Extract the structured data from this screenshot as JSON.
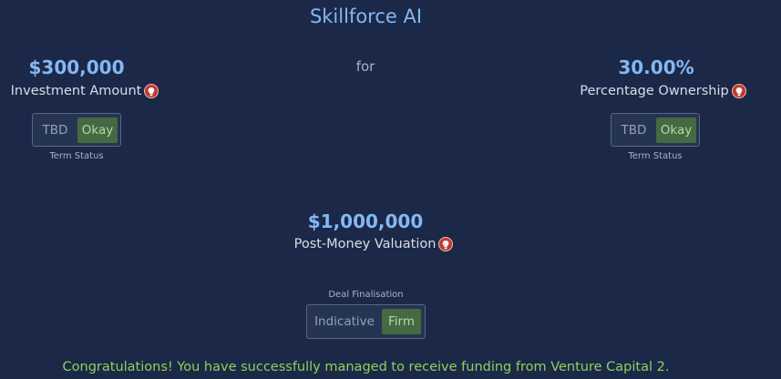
{
  "title": "Skillforce AI",
  "connector": "for",
  "investment": {
    "value": "$300,000",
    "label": "Investment Amount",
    "status": {
      "left": "TBD",
      "right": "Okay",
      "selected": "Okay",
      "caption": "Term Status"
    }
  },
  "ownership": {
    "value": "30.00%",
    "label": "Percentage Ownership",
    "status": {
      "left": "TBD",
      "right": "Okay",
      "selected": "Okay",
      "caption": "Term Status"
    }
  },
  "valuation": {
    "value": "$1,000,000",
    "label": "Post-Money Valuation"
  },
  "deal": {
    "caption": "Deal Finalisation",
    "left": "Indicative",
    "right": "Firm",
    "selected": "Firm"
  },
  "message": "Congratulations! You have successfully managed to receive funding from Venture Capital 2.",
  "icons": {
    "help": "lightbulb-help-icon"
  },
  "colors": {
    "background": "#1c2848",
    "accent": "#83b8f3",
    "help": "#c4382a",
    "selected": "#456943",
    "success": "#8fd15a"
  }
}
